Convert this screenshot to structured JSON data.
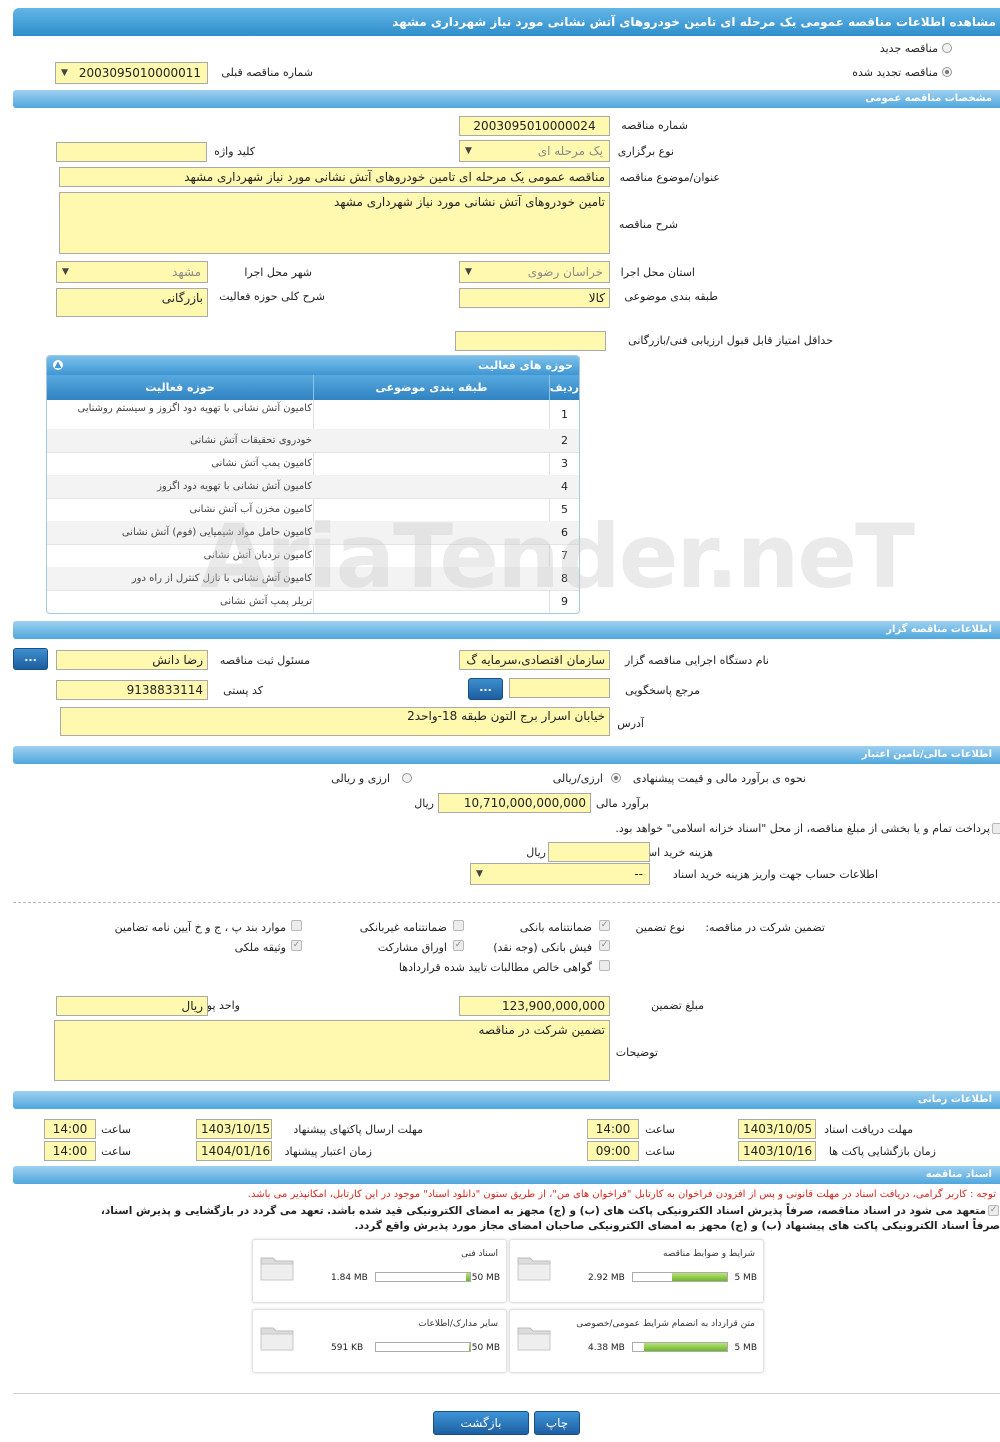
{
  "page_title": "مشاهده اطلاعات مناقصه عمومی یک مرحله ای تامین خودروهای آتش نشانی مورد نیاز شهرداری مشهد",
  "tender_kind": {
    "new_label": "مناقصه جدید",
    "renewed_label": "مناقصه تجدید شده",
    "previous_number_label": "شماره مناقصه قبلی",
    "previous_number": "2003095010000011"
  },
  "general": {
    "section_title": "مشخصات مناقصه عمومی",
    "tender_number_label": "شماره مناقصه",
    "tender_number": "2003095010000024",
    "holding_type_label": "نوع برگزاری",
    "holding_type": "یک مرحله ای",
    "keyword_label": "کلید واژه",
    "keyword": "",
    "subject_label": "عنوان/موضوع مناقصه",
    "subject": "مناقصه عمومی یک مرحله ای تامین خودروهای آتش نشانی مورد نیاز شهرداری مشهد",
    "description_label": "شرح مناقصه",
    "description": "تامین خودروهای آتش نشانی مورد نیاز شهرداری مشهد",
    "province_label": "استان محل اجرا",
    "province": "خراسان رضوی",
    "city_label": "شهر محل اجرا",
    "city": "مشهد",
    "category_label": "طبقه بندی موضوعی",
    "category": "کالا",
    "activity_desc_label": "شرح کلی حوزه فعالیت",
    "activity_desc": "بازرگانی",
    "min_score_label": "حداقل امتیاز قابل قبول ارزیابی فنی/بازرگانی",
    "min_score": ""
  },
  "activities": {
    "caption": "حوزه های فعالیت",
    "headers": {
      "row": "ردیف",
      "category": "طبقه بندی موضوعی",
      "field": "حوزه فعالیت"
    },
    "rows": [
      {
        "n": "1",
        "field": "کامیون آتش نشانی با تهویه دود اگزوز و سیستم روشنایی"
      },
      {
        "n": "2",
        "field": "خودروی تحقیقات آتش نشانی"
      },
      {
        "n": "3",
        "field": "کامیون پمپ آتش نشانی"
      },
      {
        "n": "4",
        "field": "کامیون آتش نشانی با تهویه دود اگزوز"
      },
      {
        "n": "5",
        "field": "کامیون مخزن آب آتش نشانی"
      },
      {
        "n": "6",
        "field": "کامیون حامل مواد شیمیایی (فوم) آتش نشانی"
      },
      {
        "n": "7",
        "field": "کامیون نردبان آتش نشانی"
      },
      {
        "n": "8",
        "field": "کامیون آتش نشانی با نازل کنترل از راه دور"
      },
      {
        "n": "9",
        "field": "تریلر پمپ آتش نشانی"
      }
    ]
  },
  "organizer": {
    "section_title": "اطلاعات مناقصه گزار",
    "agency_label": "نام دستگاه اجرایی مناقصه گزار",
    "agency": "سازمان اقتصادی،سرمایه گ",
    "registrar_label": "مسئول ثبت مناقصه",
    "registrar": "رضا دانش",
    "reference_label": "مرجع پاسخگویی",
    "reference": "",
    "postal_label": "کد پستی",
    "postal_code": "9138833114",
    "address_label": "آدرس",
    "address": "خیابان اسرار برج التون طبقه 18-واحد2",
    "more_btn": "..."
  },
  "finance": {
    "section_title": "اطلاعات مالی/تامین اعتبار",
    "estimate_method_label": "نحوه ی برآورد مالی و قیمت پیشنهادی",
    "opt_currency": "ارزی/ریالی",
    "opt_currency_and_rial": "ارزی و ریالی",
    "estimate_label": "برآورد مالی",
    "estimate": "10,710,000,000,000",
    "estimate_unit": "ریال",
    "treasury_note": "پرداخت تمام و یا بخشی از مبلغ مناقصه، از محل \"اسناد خزانه اسلامی\" خواهد بود.",
    "doc_fee_label": "هزینه خرید اسناد",
    "doc_fee": "",
    "doc_fee_unit": "ریال",
    "account_label": "اطلاعات حساب جهت واریز هزینه خرید اسناد",
    "account": "--"
  },
  "guarantee": {
    "label": "تضمین شرکت در مناقصه:",
    "type_label": "نوع تضمین",
    "options": {
      "bank_guarantee": "ضمانتنامه بانکی",
      "non_bank_guarantee": "ضمانتنامه غیربانکی",
      "clauses": "موارد بند پ ، ج و خ آیین نامه تضامین",
      "cash_receipt": "فیش بانکی (وجه نقد)",
      "participation_bonds": "اوراق مشارکت",
      "property": "وثیقه ملکی",
      "claims_cert": "گواهی خالص مطالبات تایید شده قراردادها"
    },
    "amount_label": "مبلغ تضمین",
    "amount": "123,900,000,000",
    "currency_label": "واحد پول",
    "currency": "ریال",
    "notes_label": "توضیحات",
    "notes": "تضمین شرکت در مناقصه"
  },
  "timing": {
    "section_title": "اطلاعات زمانی",
    "receive_deadline_label": "مهلت دریافت اسناد",
    "receive_deadline": "1403/10/05",
    "send_deadline_label": "مهلت ارسال پاکتهای پیشنهاد",
    "send_deadline": "1403/10/15",
    "opening_label": "زمان بازگشایی پاکت ها",
    "opening": "1403/10/16",
    "validity_label": "زمان اعتبار پیشنهاد",
    "validity": "1404/01/16",
    "time_label": "ساعت",
    "t1": "14:00",
    "t2": "14:00",
    "t3": "09:00",
    "t4": "14:00"
  },
  "documents": {
    "section_title": "اسناد مناقصه",
    "notice": "توجه : کاربر گرامی، دریافت اسناد در مهلت قانونی و پس از افزودن فراخوان به کارتابل \"فراخوان های من\"، از طریق ستون \"دانلود اسناد\" موجود در این کارتابل، امکانپذیر می باشد.",
    "commit_1": "متعهد می شود در اسناد مناقصه، صرفاً پذیرش اسناد الکترونیکی پاکت های (ب) و (ج) مجهز به امضای الکترونیکی قید شده باشد. تعهد می گردد در بازگشایی و پذیرش اسناد،",
    "commit_2": "صرفاً اسناد الکترونیکی پاکت های پیشنهاد (ب) و (ج) مجهز به امضای الکترونیکی صاحبان امضای مجاز مورد پذیرش واقع گردد.",
    "files": [
      {
        "name": "شرایط و ضوابط مناقصه",
        "used": "2.92 MB",
        "max": "5 MB",
        "fraction": 0.58
      },
      {
        "name": "اسناد فنی",
        "used": "1.84 MB",
        "max": "50 MB",
        "fraction": 0.04
      },
      {
        "name": "متن قرارداد به انضمام شرایط عمومی/خصوصی",
        "used": "4.38 MB",
        "max": "5 MB",
        "fraction": 0.88
      },
      {
        "name": "سایر مدارک/اطلاعات",
        "used": "591 KB",
        "max": "50 MB",
        "fraction": 0.01
      }
    ]
  },
  "actions": {
    "print": "چاپ",
    "back": "بازگشت"
  },
  "watermark": "AriaTender.neT",
  "colors": {
    "field_bg": "#fff9b0",
    "header_blue": "#4fa7dd",
    "notice_red": "#d9261c",
    "progress_green": "#6db52b"
  }
}
